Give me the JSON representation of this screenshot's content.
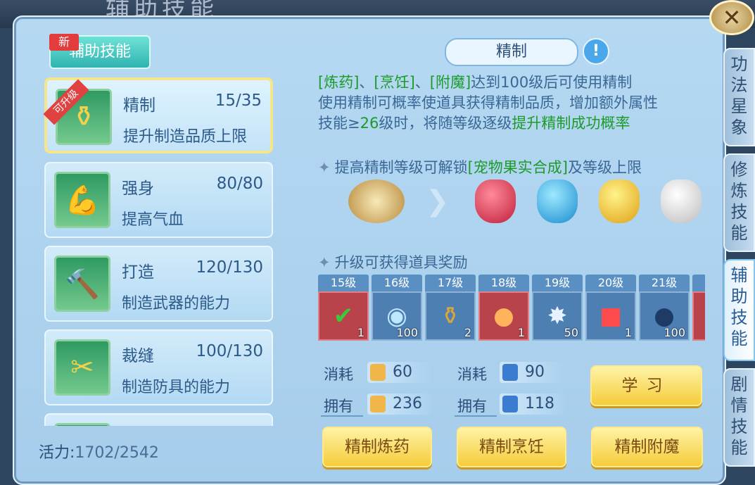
{
  "window": {
    "title_ghost": "辅助技能"
  },
  "side_tabs": [
    {
      "label": "功法星象",
      "active": false
    },
    {
      "label": "修炼技能",
      "active": false
    },
    {
      "label": "辅助技能",
      "active": true
    },
    {
      "label": "剧情技能",
      "active": false
    }
  ],
  "left": {
    "category_label": "辅助技能",
    "new_badge": "新",
    "skills": [
      {
        "name": "精制",
        "level": "15/35",
        "desc": "提升制造品质上限",
        "ribbon": "可升级",
        "icon": "potion-icon"
      },
      {
        "name": "强身",
        "level": "80/80",
        "desc": "提高气血",
        "icon": "muscle-icon"
      },
      {
        "name": "打造",
        "level": "120/130",
        "desc": "制造武器的能力",
        "icon": "hammer-icon"
      },
      {
        "name": "裁缝",
        "level": "100/130",
        "desc": "制造防具的能力",
        "icon": "scissors-icon"
      }
    ],
    "vitality_label": "活力:",
    "vitality_value": "1702/2542"
  },
  "right": {
    "skill_title": "精制",
    "desc": {
      "l1_g1": "[炼药]",
      "l1_sep1": "、",
      "l1_g2": "[烹饪]",
      "l1_sep2": "、",
      "l1_g3": "[附魔]",
      "l1_rest": "达到100级后可使用精制",
      "l2": "使用精制可概率使道具获得精制品质，增加额外属性",
      "l3_a": "技能≥",
      "l3_num": "26",
      "l3_b": "级时，将随等级逐级",
      "l3_g": "提升精制成功概率"
    },
    "unlock_title_a": "提高精制等级可解锁",
    "unlock_title_g": "[宠物果实合成]",
    "unlock_title_b": "及等级上限",
    "reward_title": "升级可获得道具奖励",
    "rewards": [
      {
        "level": "15级",
        "count": "1",
        "icon": "book-check-icon",
        "red": true
      },
      {
        "level": "16级",
        "count": "100",
        "icon": "swirl-orb-icon",
        "red": false
      },
      {
        "level": "17级",
        "count": "2",
        "icon": "vase-icon",
        "red": false
      },
      {
        "level": "18级",
        "count": "1",
        "icon": "peach-icon",
        "red": true
      },
      {
        "level": "19级",
        "count": "50",
        "icon": "crystal-icon",
        "red": false
      },
      {
        "level": "20级",
        "count": "1",
        "icon": "gift-box-icon",
        "red": false
      },
      {
        "level": "21级",
        "count": "100",
        "icon": "dark-orb-icon",
        "red": false
      }
    ],
    "cost": {
      "consume_label": "消耗",
      "own_label": "拥有",
      "gold_consume": "60",
      "gold_own": "236",
      "card_consume": "90",
      "card_own": "118"
    },
    "buttons": {
      "learn": "学习",
      "refine_alchemy": "精制炼药",
      "refine_cooking": "精制烹饪",
      "refine_enchant": "精制附魔"
    }
  }
}
